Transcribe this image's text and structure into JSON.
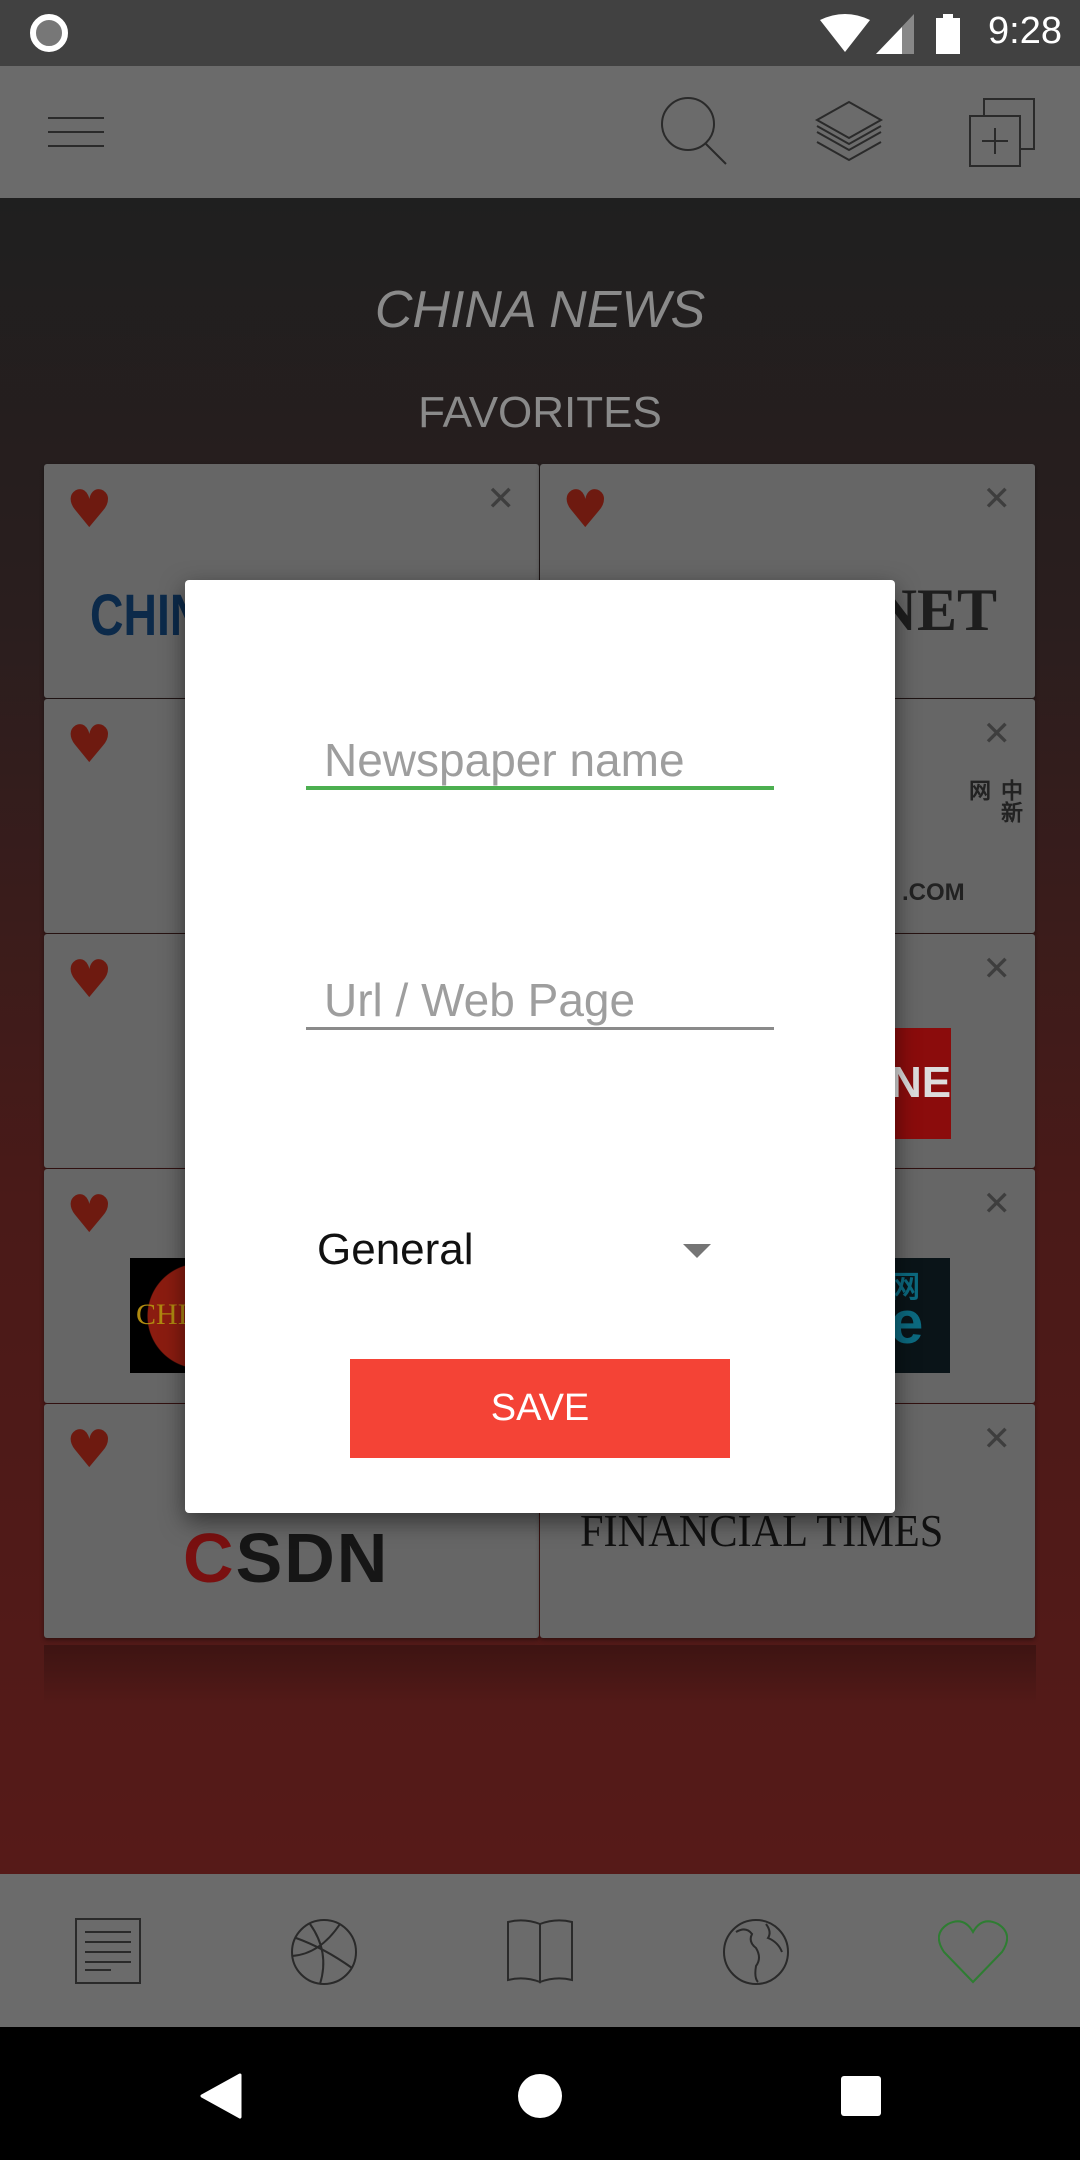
{
  "status_bar": {
    "time": "9:28"
  },
  "toolbar": {
    "icons": [
      "menu-icon",
      "search-icon",
      "layers-icon",
      "add-page-icon"
    ]
  },
  "page": {
    "title": "CHINA NEWS",
    "section": "FAVORITES"
  },
  "favorites": [
    {
      "logo": "CHINA",
      "color": "#0c2a4a"
    },
    {
      "logo": "NET",
      "color": "#1e1e1e"
    },
    {
      "logo": "",
      "color": ""
    },
    {
      "logo": ".COM",
      "chars": "中新网",
      "color": "#8b1010"
    },
    {
      "logo": "",
      "color": ""
    },
    {
      "logo": "NE",
      "color": "#7a0c0c"
    },
    {
      "logo": "CHI",
      "color": "#b08a10"
    },
    {
      "logo": "e",
      "chars": "网",
      "color": "#0c6a80"
    },
    {
      "logo": "SDN",
      "first": "C",
      "color": "#7a1010"
    },
    {
      "logo": "FINANCIAL TIMES",
      "color": "#111111"
    }
  ],
  "dialog": {
    "name_placeholder": "Newspaper name",
    "url_placeholder": "Url / Web Page",
    "category": "General",
    "save_label": "SAVE",
    "accent": "#4caf50",
    "button_color": "#f44336"
  },
  "bottom_nav": {
    "items": [
      "news-icon",
      "sports-icon",
      "book-icon",
      "world-icon",
      "favorites-icon"
    ],
    "active": "favorites-icon",
    "active_color": "#2e7d32"
  }
}
